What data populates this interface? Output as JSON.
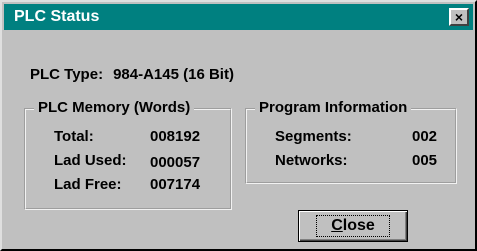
{
  "window": {
    "title": "PLC Status",
    "close_glyph": "×"
  },
  "plc_type": {
    "label": "PLC Type:",
    "value": "984-A145 (16 Bit)"
  },
  "memory": {
    "legend": "PLC Memory (Words)",
    "rows": [
      {
        "label": "Total:",
        "value": "008192"
      },
      {
        "label": "Lad Used:",
        "value": "000057"
      },
      {
        "label": "Lad Free:",
        "value": "007174"
      }
    ]
  },
  "program": {
    "legend": "Program Information",
    "rows": [
      {
        "label": "Segments:",
        "value": "002"
      },
      {
        "label": "Networks:",
        "value": "005"
      }
    ]
  },
  "button": {
    "mnemonic": "C",
    "rest": "lose"
  },
  "colors": {
    "titlebar": "#008080",
    "face": "#c0c0c0"
  }
}
